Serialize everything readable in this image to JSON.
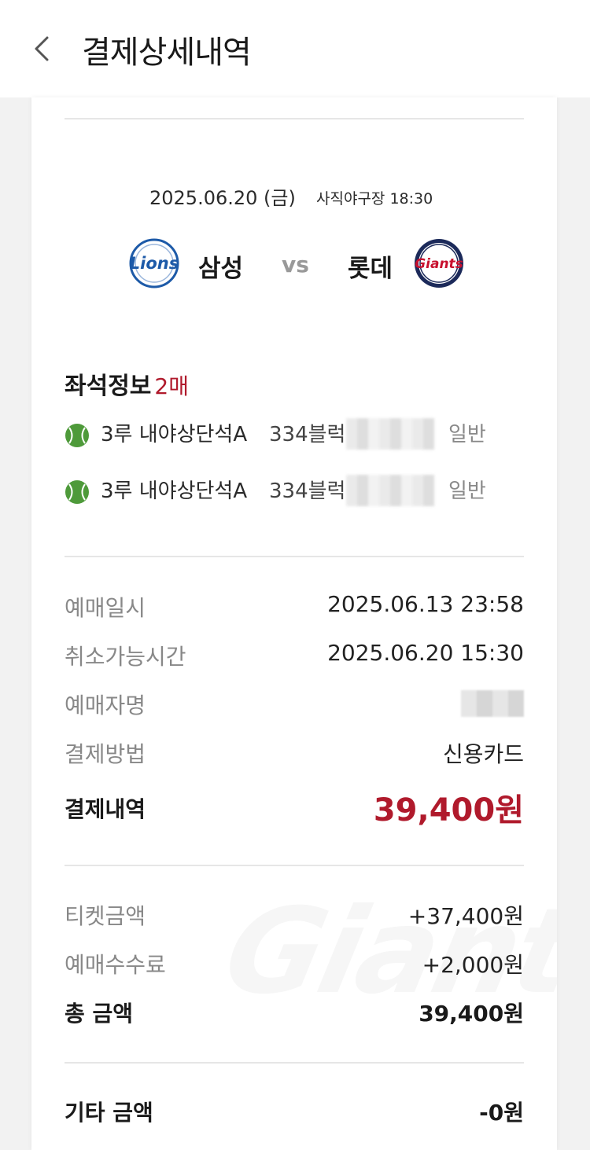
{
  "header": {
    "title": "결제상세내역"
  },
  "game": {
    "date": "2025.06.20 (금)",
    "venue": "사직야구장 18:30",
    "home_team": "삼성",
    "away_team": "롯데",
    "vs": "vs",
    "home_logo_text": "Lions",
    "away_logo_text": "Giants"
  },
  "seats": {
    "title": "좌석정보",
    "count": "2매",
    "items": [
      {
        "section": "3루 내야상단석A",
        "block": "334블럭",
        "type": "일반"
      },
      {
        "section": "3루 내야상단석A",
        "block": "334블럭",
        "type": "일반"
      }
    ]
  },
  "booking": {
    "rows": [
      {
        "label": "예매일시",
        "value": "2025.06.13 23:58"
      },
      {
        "label": "취소가능시간",
        "value": "2025.06.20 15:30"
      },
      {
        "label": "예매자명",
        "value": ""
      },
      {
        "label": "결제방법",
        "value": "신용카드"
      }
    ],
    "payment_label": "결제내역",
    "payment_value": "39,400원"
  },
  "breakdown": {
    "ticket_label": "티켓금액",
    "ticket_value": "+37,400원",
    "fee_label": "예매수수료",
    "fee_value": "+2,000원",
    "total_label": "총 금액",
    "total_value": "39,400원"
  },
  "other": {
    "label": "기타 금액",
    "value": "-0원"
  },
  "watermark_text": "Giants",
  "colors": {
    "accent": "#b01a2c",
    "lions_blue": "#1d5aa8",
    "giants_navy": "#1c2a5a",
    "ball_green": "#4e9a3a"
  }
}
